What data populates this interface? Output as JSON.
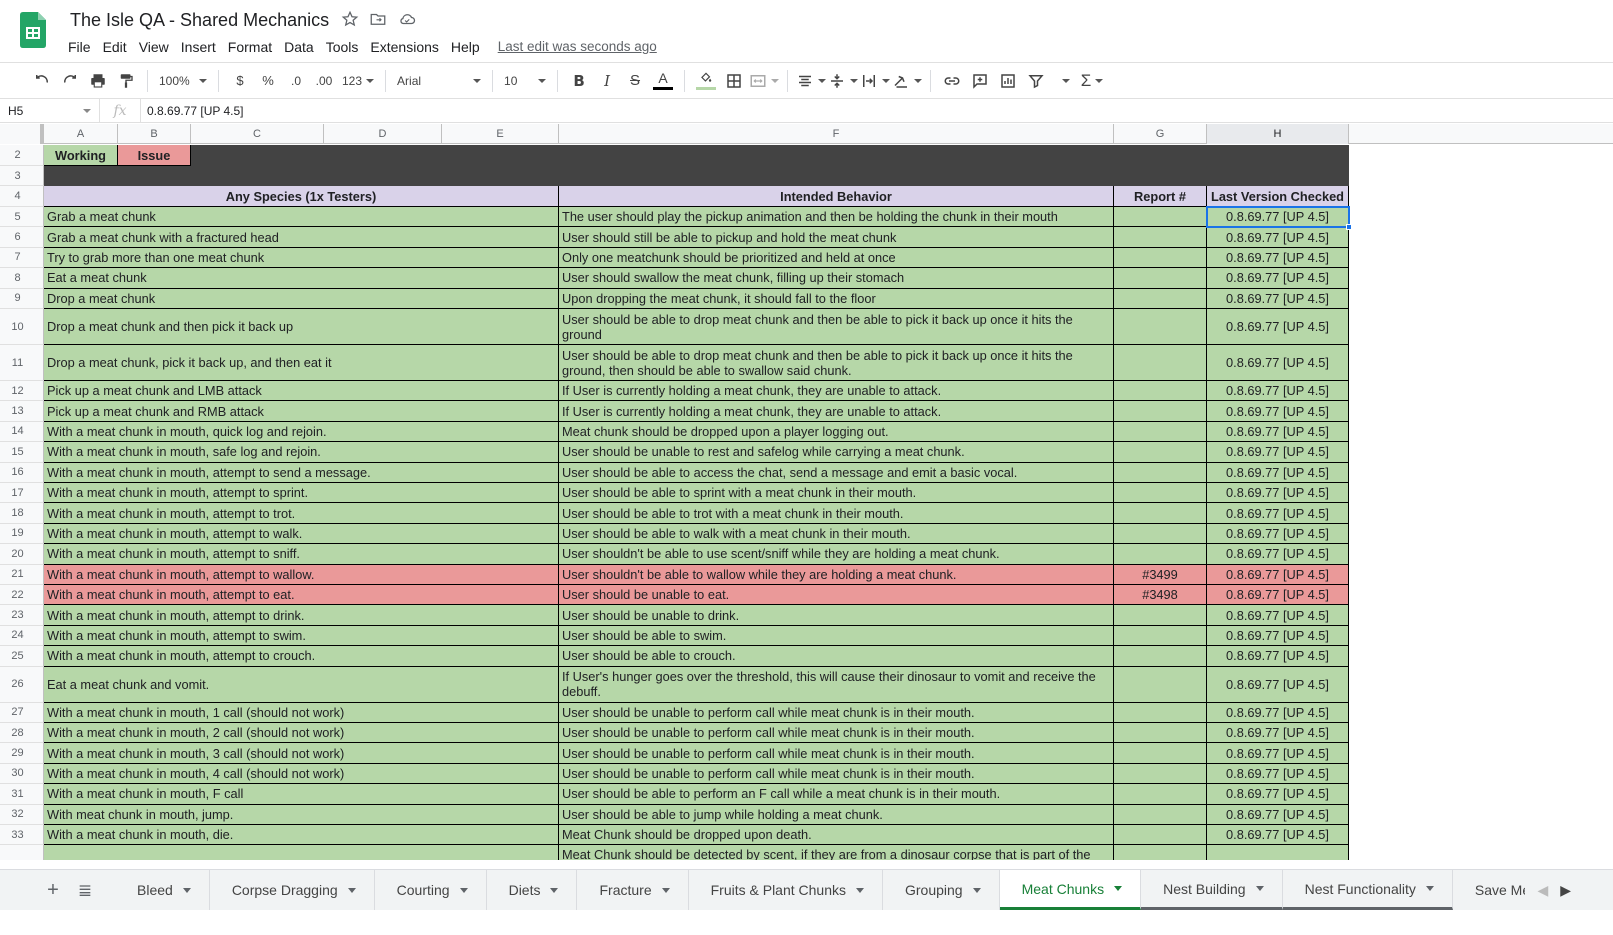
{
  "doc": {
    "title": "The Isle QA - Shared Mechanics",
    "last_edit": "Last edit was seconds ago"
  },
  "menu": [
    "File",
    "Edit",
    "View",
    "Insert",
    "Format",
    "Data",
    "Tools",
    "Extensions",
    "Help"
  ],
  "toolbar": {
    "zoom": "100%",
    "currency": "$",
    "percent": "%",
    "dec_decrease": ".0",
    "dec_increase": ".00",
    "more_formats": "123",
    "font": "Arial",
    "font_size": "10"
  },
  "formula": {
    "cell_ref": "H5",
    "fx": "fx",
    "value": "0.8.69.77 [UP 4.5]"
  },
  "columns": [
    "A",
    "B",
    "C",
    "D",
    "E",
    "F",
    "G",
    "H"
  ],
  "legend": {
    "working": "Working",
    "issue": "Issue"
  },
  "headers": {
    "species": "Any Species (1x Testers)",
    "intended": "Intended Behavior",
    "report": "Report #",
    "version": "Last Version Checked"
  },
  "row_numbers": {
    "legend": "2",
    "spacer": "3",
    "header": "4"
  },
  "rows": [
    {
      "n": "5",
      "status": "working",
      "test": "Grab a meat chunk",
      "behavior": "The user should play the pickup animation and then be holding the chunk in their mouth",
      "report": "",
      "version": "0.8.69.77 [UP 4.5]"
    },
    {
      "n": "6",
      "status": "working",
      "test": "Grab a meat chunk with a fractured head",
      "behavior": "User should still be able to pickup and hold the meat chunk",
      "report": "",
      "version": "0.8.69.77 [UP 4.5]"
    },
    {
      "n": "7",
      "status": "working",
      "test": "Try to grab more than one meat chunk",
      "behavior": "Only one meatchunk should be prioritized and held at once",
      "report": "",
      "version": "0.8.69.77 [UP 4.5]"
    },
    {
      "n": "8",
      "status": "working",
      "test": "Eat a meat chunk",
      "behavior": "User should swallow the meat chunk, filling up their stomach",
      "report": "",
      "version": "0.8.69.77 [UP 4.5]"
    },
    {
      "n": "9",
      "status": "working",
      "test": "Drop a meat chunk",
      "behavior": "Upon dropping the meat chunk, it should fall to the floor",
      "report": "",
      "version": "0.8.69.77 [UP 4.5]"
    },
    {
      "n": "10",
      "status": "working",
      "tall": true,
      "test": "Drop a meat chunk and then pick it back up",
      "behavior": "User should be able to drop meat chunk and then be able to pick it back up once it hits the ground",
      "report": "",
      "version": "0.8.69.77 [UP 4.5]"
    },
    {
      "n": "11",
      "status": "working",
      "tall": true,
      "test": "Drop a meat chunk, pick it back up, and then eat it",
      "behavior": "User should be able to drop meat chunk and then be able to pick it back up once it hits the ground, then should be able to swallow said chunk.",
      "report": "",
      "version": "0.8.69.77 [UP 4.5]"
    },
    {
      "n": "12",
      "status": "working",
      "test": "Pick up a meat chunk and LMB attack",
      "behavior": "If User is currently holding a meat chunk, they are unable to attack.",
      "report": "",
      "version": "0.8.69.77 [UP 4.5]"
    },
    {
      "n": "13",
      "status": "working",
      "test": "Pick up a meat chunk and RMB attack",
      "behavior": "If User is currently holding a meat chunk, they are unable to attack.",
      "report": "",
      "version": "0.8.69.77 [UP 4.5]"
    },
    {
      "n": "14",
      "status": "working",
      "test": "With a meat chunk in mouth, quick log and rejoin.",
      "behavior": "Meat chunk should be dropped upon a player logging out.",
      "report": "",
      "version": "0.8.69.77 [UP 4.5]"
    },
    {
      "n": "15",
      "status": "working",
      "test": "With a meat chunk in mouth, safe log and rejoin.",
      "behavior": "User should be unable to rest and safelog while carrying a meat chunk.",
      "report": "",
      "version": "0.8.69.77 [UP 4.5]"
    },
    {
      "n": "16",
      "status": "working",
      "test": "With a meat chunk in mouth, attempt to send a message.",
      "behavior": "User should be able to access the chat, send a message and emit a basic vocal.",
      "report": "",
      "version": "0.8.69.77 [UP 4.5]"
    },
    {
      "n": "17",
      "status": "working",
      "test": "With a meat chunk in mouth, attempt to sprint.",
      "behavior": "User should be able to sprint with a meat chunk in their mouth.",
      "report": "",
      "version": "0.8.69.77 [UP 4.5]"
    },
    {
      "n": "18",
      "status": "working",
      "test": "With a meat chunk in mouth, attempt to trot.",
      "behavior": "User should be able to trot with a meat chunk in their mouth.",
      "report": "",
      "version": "0.8.69.77 [UP 4.5]"
    },
    {
      "n": "19",
      "status": "working",
      "test": "With a meat chunk in mouth, attempt to walk.",
      "behavior": "User should be able to walk with a meat chunk in their mouth.",
      "report": "",
      "version": "0.8.69.77 [UP 4.5]"
    },
    {
      "n": "20",
      "status": "working",
      "test": "With a meat chunk in mouth, attempt to sniff.",
      "behavior": "User shouldn't be able to use scent/sniff while they are holding a meat chunk.",
      "report": "",
      "version": "0.8.69.77 [UP 4.5]"
    },
    {
      "n": "21",
      "status": "issue",
      "test": "With a meat chunk in mouth, attempt to wallow.",
      "behavior": "User shouldn't be able to wallow while they are holding a meat chunk.",
      "report": "#3499",
      "version": "0.8.69.77 [UP 4.5]"
    },
    {
      "n": "22",
      "status": "issue",
      "test": "With a meat chunk in mouth, attempt to eat.",
      "behavior": "User should be unable to eat.",
      "report": "#3498",
      "version": "0.8.69.77 [UP 4.5]"
    },
    {
      "n": "23",
      "status": "working",
      "test": "With a meat chunk in mouth, attempt to drink.",
      "behavior": "User should be unable to drink.",
      "report": "",
      "version": "0.8.69.77 [UP 4.5]"
    },
    {
      "n": "24",
      "status": "working",
      "test": "With a meat chunk in mouth, attempt to swim.",
      "behavior": "User should be able to swim.",
      "report": "",
      "version": "0.8.69.77 [UP 4.5]"
    },
    {
      "n": "25",
      "status": "working",
      "test": "With a meat chunk in mouth, attempt to crouch.",
      "behavior": "User should be able to crouch.",
      "report": "",
      "version": "0.8.69.77 [UP 4.5]"
    },
    {
      "n": "26",
      "status": "working",
      "tall": true,
      "test": "Eat a meat chunk and vomit.",
      "behavior": "If User's hunger goes over the threshold, this will cause their dinosaur to vomit and receive the debuff.",
      "report": "",
      "version": "0.8.69.77 [UP 4.5]"
    },
    {
      "n": "27",
      "status": "working",
      "test": "With a meat chunk in mouth, 1 call (should not work)",
      "behavior": "User should be unable to perform call while meat chunk is in their mouth.",
      "report": "",
      "version": "0.8.69.77 [UP 4.5]"
    },
    {
      "n": "28",
      "status": "working",
      "test": "With a meat chunk in mouth, 2 call (should not work)",
      "behavior": "User should be unable to perform call while meat chunk is in their mouth.",
      "report": "",
      "version": "0.8.69.77 [UP 4.5]"
    },
    {
      "n": "29",
      "status": "working",
      "test": "With a meat chunk in mouth, 3 call (should not work)",
      "behavior": "User should be unable to perform call while meat chunk is in their mouth.",
      "report": "",
      "version": "0.8.69.77 [UP 4.5]"
    },
    {
      "n": "30",
      "status": "working",
      "test": "With a meat chunk in mouth, 4 call (should not work)",
      "behavior": "User should be unable to perform call while meat chunk is in their mouth.",
      "report": "",
      "version": "0.8.69.77 [UP 4.5]"
    },
    {
      "n": "31",
      "status": "working",
      "test": "With a meat chunk in mouth, F call",
      "behavior": "User should be able to perform an F call while a meat chunk is in their mouth.",
      "report": "",
      "version": "0.8.69.77 [UP 4.5]"
    },
    {
      "n": "32",
      "status": "working",
      "test": "With meat chunk in mouth, jump.",
      "behavior": "User should be able to jump while holding a meat chunk.",
      "report": "",
      "version": "0.8.69.77 [UP 4.5]"
    },
    {
      "n": "33",
      "status": "working",
      "test": "With a meat chunk in mouth, die.",
      "behavior": "Meat Chunk should be dropped upon death.",
      "report": "",
      "version": "0.8.69.77 [UP 4.5]"
    },
    {
      "n": "",
      "status": "working",
      "tall": true,
      "partial": true,
      "test": "",
      "behavior": "Meat Chunk should be detected by scent, if they are from a dinosaur corpse that is part of the",
      "report": "",
      "version": ""
    }
  ],
  "sheets": [
    {
      "label": "Bleed",
      "active": false
    },
    {
      "label": "Corpse Dragging",
      "active": false
    },
    {
      "label": "Courting",
      "active": false
    },
    {
      "label": "Diets",
      "active": false
    },
    {
      "label": "Fracture",
      "active": false
    },
    {
      "label": "Fruits & Plant Chunks",
      "active": false
    },
    {
      "label": "Grouping",
      "active": false
    },
    {
      "label": "Meat Chunks",
      "active": true
    },
    {
      "label": "Nest Building",
      "active": false
    },
    {
      "label": "Nest Functionality",
      "active": false
    },
    {
      "label": "Save Mech",
      "active": false
    }
  ],
  "colors": {
    "working": "#b6d7a8",
    "issue": "#ea9999",
    "header": "#d9d2e9",
    "dark_band": "#434343",
    "selection": "#1a73e8",
    "active_tab": "#188038"
  }
}
